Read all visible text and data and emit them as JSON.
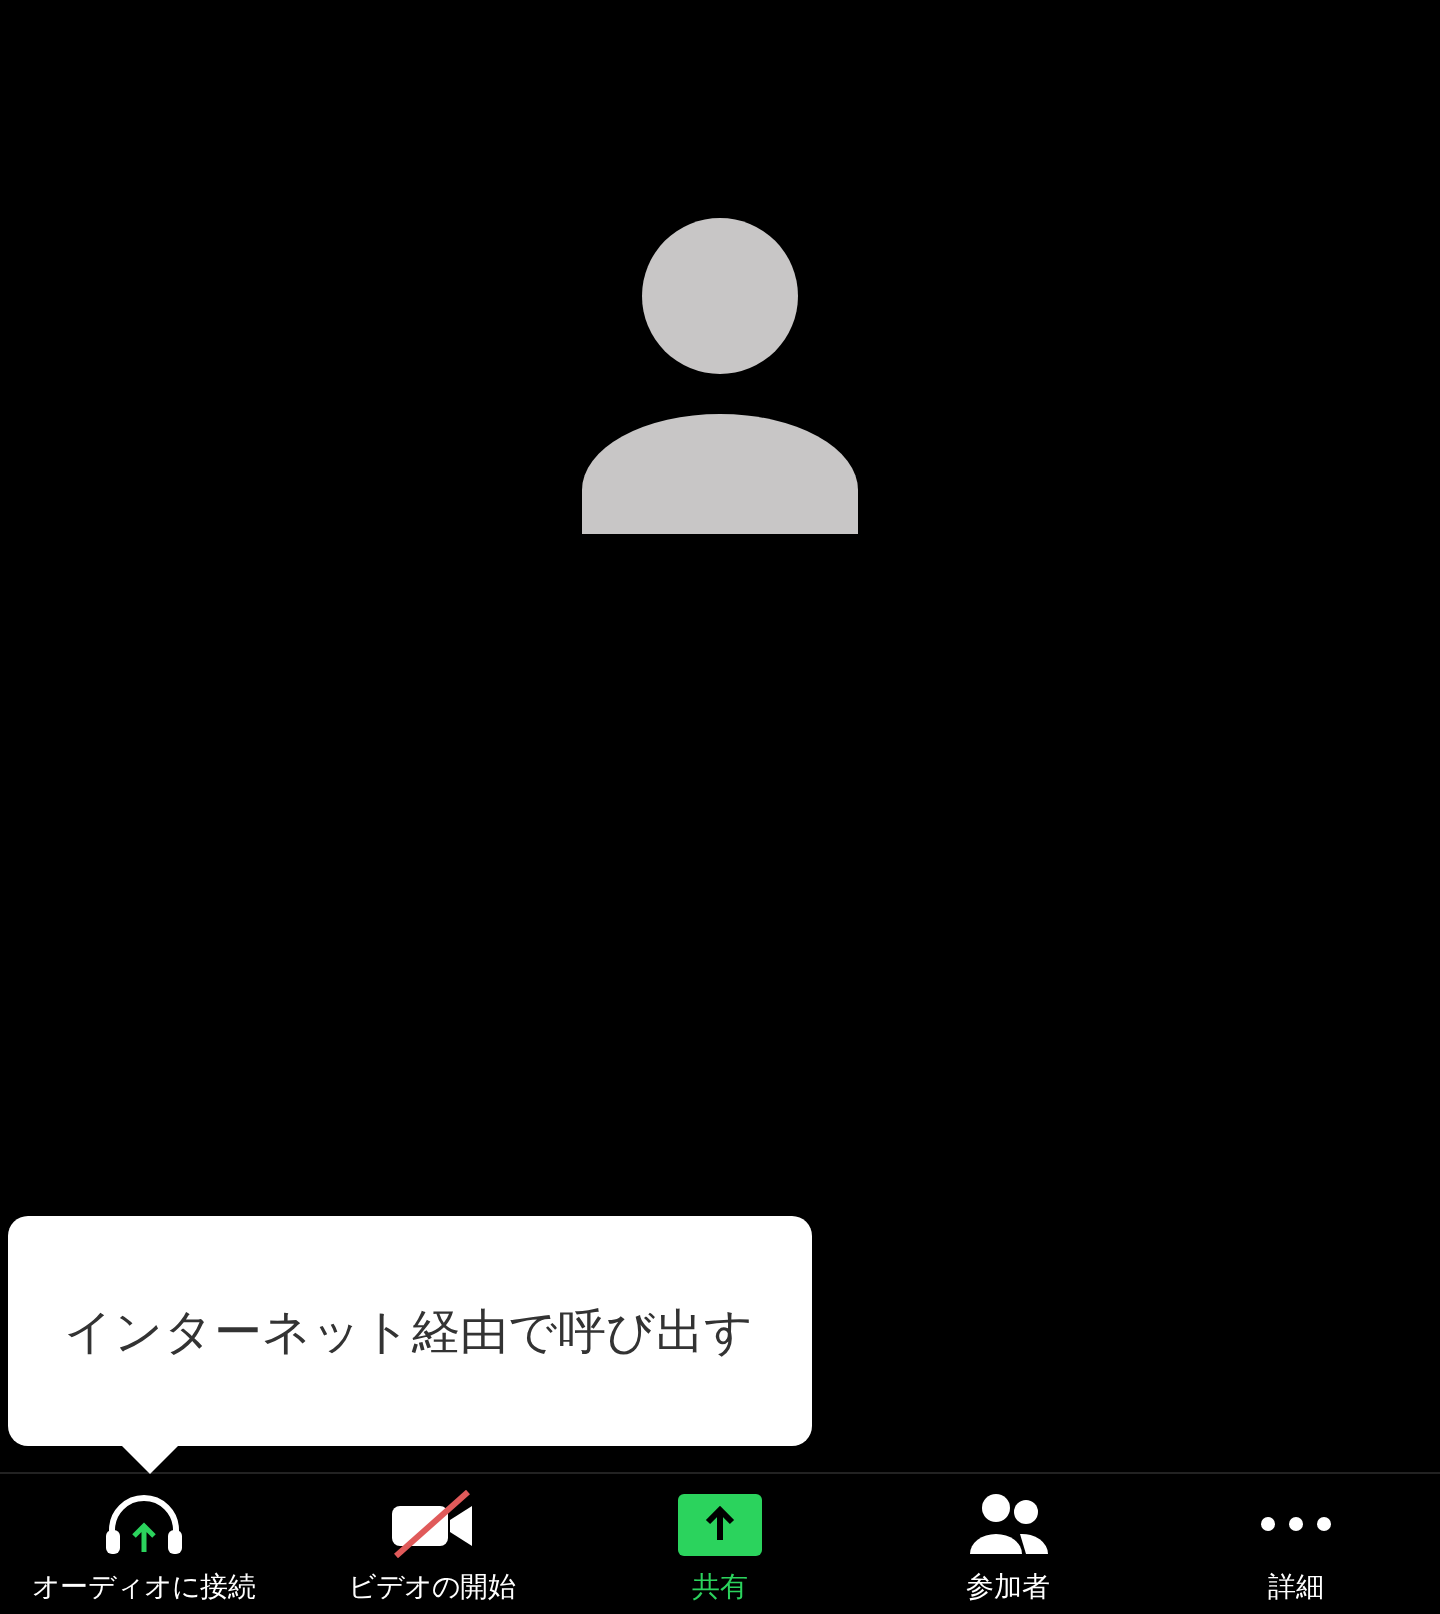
{
  "tooltip": {
    "text": "インターネット経由で呼び出す"
  },
  "toolbar": [
    {
      "kind": "audio",
      "label": "オーディオに接続"
    },
    {
      "kind": "video",
      "label": "ビデオの開始"
    },
    {
      "kind": "share",
      "label": "共有"
    },
    {
      "kind": "participants",
      "label": "参加者"
    },
    {
      "kind": "more",
      "label": "詳細"
    }
  ]
}
